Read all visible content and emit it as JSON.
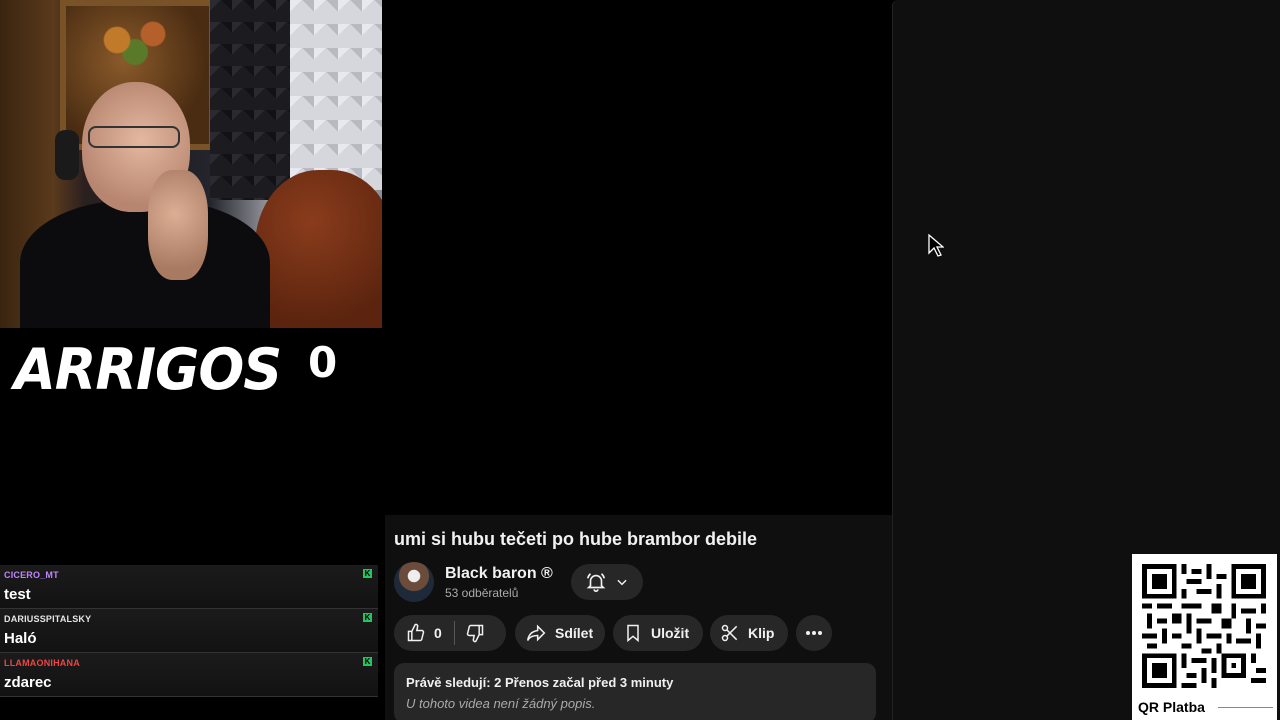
{
  "stream": {
    "logo_text": "ARRIGOS",
    "score": "0"
  },
  "chat": {
    "messages": [
      {
        "user": "CICERO_MT",
        "text": "test",
        "user_color": "#c084fc"
      },
      {
        "user": "DARIUSSPITALSKY",
        "text": "Haló",
        "user_color": "#e5e5e5"
      },
      {
        "user": "LLAMAONIHANA",
        "text": "zdarec",
        "user_color": "#ef4444"
      }
    ]
  },
  "video": {
    "title": "umi si hubu tečeti po hube brambor debile",
    "channel_name": "Black baron ®",
    "subscribers": "53 odběratelů",
    "likes": "0",
    "share_label": "Sdílet",
    "save_label": "Uložit",
    "clip_label": "Klip",
    "stats": "Právě sledují: 2  Přenos začal před 3 minuty",
    "description": "U tohoto videa není žádný popis."
  },
  "qr": {
    "label": "QR Platba"
  },
  "colors": {
    "panel_bg": "#0f0f0f",
    "button_bg": "#272727",
    "chat_badge": "#22c55e"
  }
}
